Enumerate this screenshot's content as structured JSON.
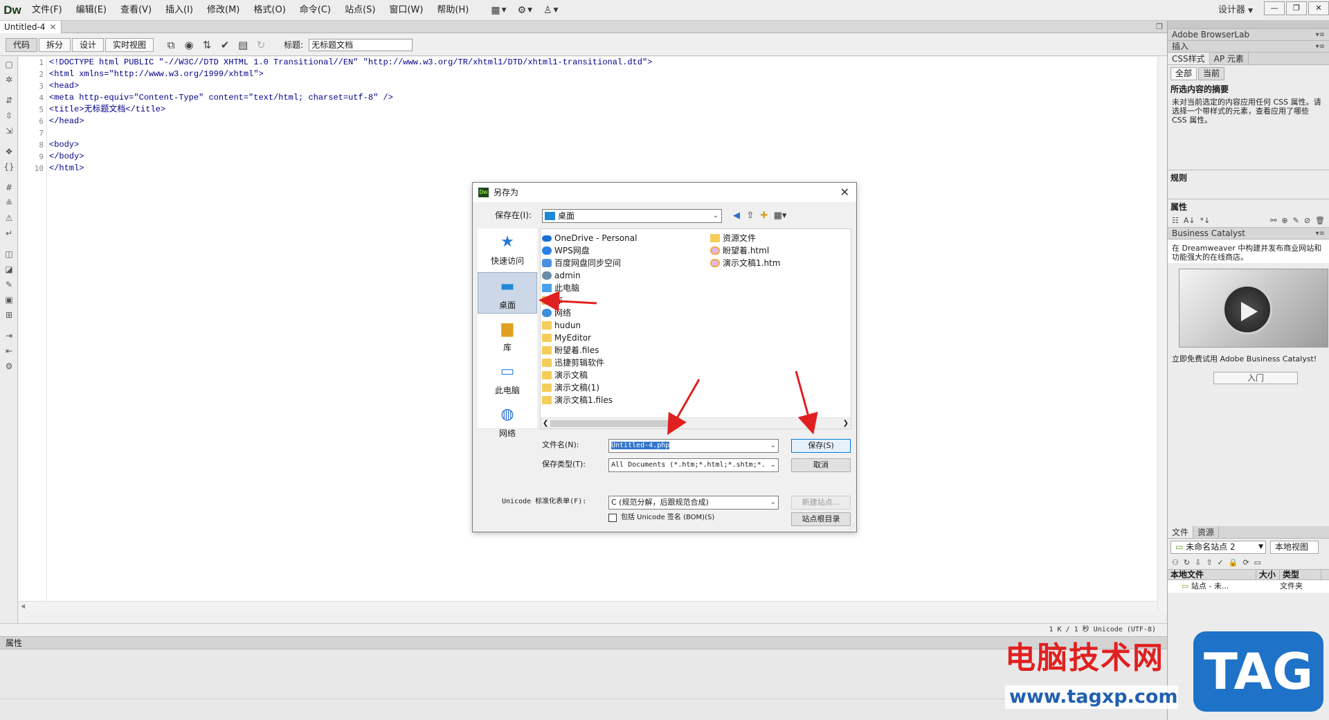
{
  "app": {
    "logo": "Dw"
  },
  "menu": [
    "文件(F)",
    "编辑(E)",
    "查看(V)",
    "插入(I)",
    "修改(M)",
    "格式(O)",
    "命令(C)",
    "站点(S)",
    "窗口(W)",
    "帮助(H)"
  ],
  "workspace": "设计器",
  "document": {
    "tab": "Untitled-4",
    "views": [
      "代码",
      "拆分",
      "设计",
      "实时视图"
    ],
    "title_label": "标题:",
    "title_value": "无标题文档",
    "line_numbers": [
      "1",
      "2",
      "3",
      "4",
      "5",
      "6",
      "7",
      "8",
      "9",
      "10"
    ],
    "code_lines": [
      "<!DOCTYPE html PUBLIC \"-//W3C//DTD XHTML 1.0 Transitional//EN\" \"http://www.w3.org/TR/xhtml1/DTD/xhtml1-transitional.dtd\">",
      "<html xmlns=\"http://www.w3.org/1999/xhtml\">",
      "<head>",
      "<meta http-equiv=\"Content-Type\" content=\"text/html; charset=utf-8\" />",
      "<title>无标题文档</title>",
      "</head>",
      "",
      "<body>",
      "</body>",
      "</html>"
    ],
    "status": "1 K / 1 秒 Unicode (UTF-8)"
  },
  "properties_bar": {
    "title": "属性"
  },
  "right_panel": {
    "browserlab": "Adobe BrowserLab",
    "insert": "插入",
    "css_tabs": [
      "CSS样式",
      "AP 元素"
    ],
    "css_buttons": [
      "全部",
      "当前"
    ],
    "summary_head": "所选内容的摘要",
    "summary_text": "未对当前选定的内容应用任何 CSS 属性。请选择一个带样式的元素，查看应用了哪些 CSS 属性。",
    "rules_head": "规则",
    "props_head": "属性",
    "bc_title": "Business Catalyst",
    "bc_text": "在 Dreamweaver 中构建并发布商业网站和功能强大的在线商店。",
    "bc_trial": "立即免费试用 Adobe Business Catalyst!",
    "bc_enter": "入门",
    "files_tabs": [
      "文件",
      "资源"
    ],
    "site_select": "未命名站点 2",
    "view_select": "本地视图",
    "files_columns": [
      "本地文件",
      "大小",
      "类型"
    ],
    "file_row": {
      "name": "站点 - 未...",
      "type": "文件夹"
    }
  },
  "dialog": {
    "title": "另存为",
    "save_in_label": "保存在(I):",
    "save_in_value": "桌面",
    "places": [
      "快速访问",
      "桌面",
      "库",
      "此电脑",
      "网络"
    ],
    "files_col1": [
      "OneDrive - Personal",
      "WPS网盘",
      "百度网盘同步空间",
      "admin",
      "此电脑",
      "库",
      "网络",
      "hudun",
      "MyEditor",
      "盼望着.files",
      "迅捷剪辑软件",
      "演示文稿",
      "演示文稿(1)",
      "演示文稿1.files"
    ],
    "files_col2": [
      "资源文件",
      "盼望着.html",
      "演示文稿1.htm"
    ],
    "filename_label": "文件名(N):",
    "filename_value": "Untitled-4.php",
    "filetype_label": "保存类型(T):",
    "filetype_value": "All Documents (*.htm;*.html;*.shtm;*.",
    "save_button": "保存(S)",
    "cancel_button": "取消",
    "unicode_label": "Unicode 标准化表单(F):",
    "unicode_value": "C (规范分解，后跟规范合成)",
    "new_site_button": "新建站点...",
    "bom_label": "包括 Unicode 签名 (BOM)(S)",
    "site_root_button": "站点根目录"
  },
  "watermark": {
    "cn": "电脑技术网",
    "url": "www.tagxp.com",
    "tag": "TAG"
  },
  "colors": {
    "arrow": "#e02020",
    "selection": "#3276cc",
    "code": "#00008b"
  }
}
